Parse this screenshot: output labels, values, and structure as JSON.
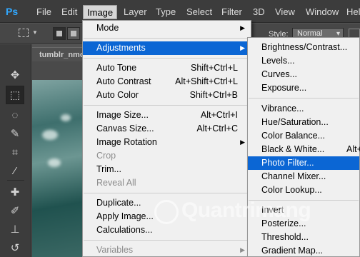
{
  "app_logo": "Ps",
  "menubar": {
    "items": [
      {
        "label": "File",
        "active": false
      },
      {
        "label": "Edit",
        "active": false
      },
      {
        "label": "Image",
        "active": true
      },
      {
        "label": "Layer",
        "active": false
      },
      {
        "label": "Type",
        "active": false
      },
      {
        "label": "Select",
        "active": false
      },
      {
        "label": "Filter",
        "active": false
      },
      {
        "label": "3D",
        "active": false
      },
      {
        "label": "View",
        "active": false
      },
      {
        "label": "Window",
        "active": false
      },
      {
        "label": "Help",
        "active": false
      }
    ]
  },
  "options_bar": {
    "style_label": "Style:",
    "style_value": "Normal"
  },
  "document": {
    "tab_title": "tumblr_nmo"
  },
  "image_menu": {
    "items": [
      {
        "label": "Mode",
        "shortcut": "",
        "submenu": true,
        "disabled": false,
        "highlighted": false
      },
      {
        "label": "Adjustments",
        "shortcut": "",
        "submenu": true,
        "disabled": false,
        "highlighted": true
      },
      {
        "label": "Auto Tone",
        "shortcut": "Shift+Ctrl+L",
        "submenu": false,
        "disabled": false,
        "highlighted": false
      },
      {
        "label": "Auto Contrast",
        "shortcut": "Alt+Shift+Ctrl+L",
        "submenu": false,
        "disabled": false,
        "highlighted": false
      },
      {
        "label": "Auto Color",
        "shortcut": "Shift+Ctrl+B",
        "submenu": false,
        "disabled": false,
        "highlighted": false
      },
      {
        "label": "Image Size...",
        "shortcut": "Alt+Ctrl+I",
        "submenu": false,
        "disabled": false,
        "highlighted": false
      },
      {
        "label": "Canvas Size...",
        "shortcut": "Alt+Ctrl+C",
        "submenu": false,
        "disabled": false,
        "highlighted": false
      },
      {
        "label": "Image Rotation",
        "shortcut": "",
        "submenu": true,
        "disabled": false,
        "highlighted": false
      },
      {
        "label": "Crop",
        "shortcut": "",
        "submenu": false,
        "disabled": true,
        "highlighted": false
      },
      {
        "label": "Trim...",
        "shortcut": "",
        "submenu": false,
        "disabled": false,
        "highlighted": false
      },
      {
        "label": "Reveal All",
        "shortcut": "",
        "submenu": false,
        "disabled": true,
        "highlighted": false
      },
      {
        "label": "Duplicate...",
        "shortcut": "",
        "submenu": false,
        "disabled": false,
        "highlighted": false
      },
      {
        "label": "Apply Image...",
        "shortcut": "",
        "submenu": false,
        "disabled": false,
        "highlighted": false
      },
      {
        "label": "Calculations...",
        "shortcut": "",
        "submenu": false,
        "disabled": false,
        "highlighted": false
      },
      {
        "label": "Variables",
        "shortcut": "",
        "submenu": true,
        "disabled": true,
        "highlighted": false
      }
    ]
  },
  "adjustments_menu": {
    "items": [
      {
        "label": "Brightness/Contrast...",
        "shortcut": "",
        "highlighted": false
      },
      {
        "label": "Levels...",
        "shortcut": "",
        "highlighted": false
      },
      {
        "label": "Curves...",
        "shortcut": "",
        "highlighted": false
      },
      {
        "label": "Exposure...",
        "shortcut": "",
        "highlighted": false
      },
      {
        "label": "Vibrance...",
        "shortcut": "",
        "highlighted": false
      },
      {
        "label": "Hue/Saturation...",
        "shortcut": "",
        "highlighted": false
      },
      {
        "label": "Color Balance...",
        "shortcut": "",
        "highlighted": false
      },
      {
        "label": "Black & White...",
        "shortcut": "Alt+",
        "highlighted": false
      },
      {
        "label": "Photo Filter...",
        "shortcut": "",
        "highlighted": true
      },
      {
        "label": "Channel Mixer...",
        "shortcut": "",
        "highlighted": false
      },
      {
        "label": "Color Lookup...",
        "shortcut": "",
        "highlighted": false
      },
      {
        "label": "Invert",
        "shortcut": "",
        "highlighted": false
      },
      {
        "label": "Posterize...",
        "shortcut": "",
        "highlighted": false
      },
      {
        "label": "Threshold...",
        "shortcut": "",
        "highlighted": false
      },
      {
        "label": "Gradient Map...",
        "shortcut": "",
        "highlighted": false
      }
    ]
  },
  "watermark": "Quantrimang",
  "colors": {
    "highlight": "#0b66d4",
    "menubar_bg": "#3c3c3c",
    "menu_bg": "#f0f0f0"
  },
  "tools": [
    "move-icon",
    "marquee-icon",
    "lasso-icon",
    "quick-select-icon",
    "crop-icon",
    "eyedropper-icon",
    "healing-brush-icon",
    "brush-icon",
    "clone-stamp-icon",
    "history-brush-icon"
  ]
}
